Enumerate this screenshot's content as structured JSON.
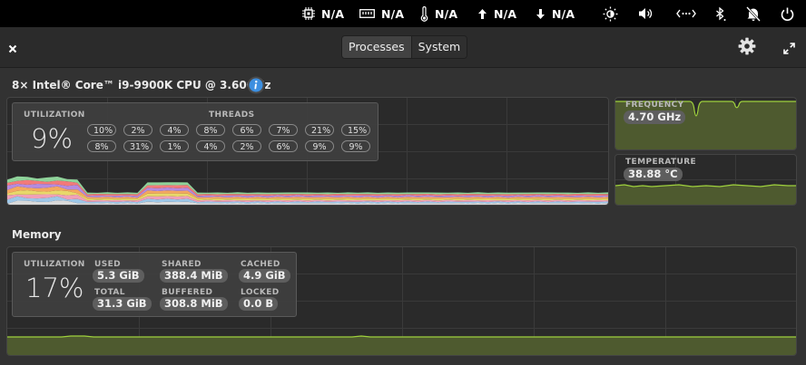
{
  "panel": {
    "cpu": "N/A",
    "memory": "N/A",
    "temperature": "N/A",
    "upload": "N/A",
    "download": "N/A",
    "icons": [
      "cpu-chip-icon",
      "memory-icon",
      "thermometer-icon",
      "arrow-up-icon",
      "arrow-down-icon",
      "brightness-icon",
      "volume-icon",
      "network-icon",
      "bluetooth-icon",
      "notifications-muted-icon",
      "power-icon"
    ]
  },
  "header": {
    "tabs": [
      "Processes",
      "System"
    ],
    "active_tab": "Processes"
  },
  "cpu": {
    "title": "8× Intel® Core™ i9-9900K CPU @ 3.60GHz",
    "utilization_label": "UTILIZATION",
    "utilization_value": "9%",
    "threads_label": "THREADS",
    "threads": [
      "10%",
      "2%",
      "4%",
      "8%",
      "6%",
      "7%",
      "21%",
      "15%",
      "8%",
      "31%",
      "1%",
      "4%",
      "2%",
      "6%",
      "9%",
      "9%"
    ],
    "frequency_label": "FREQUENCY",
    "frequency_value": "4.70 GHz",
    "temperature_label": "TEMPERATURE",
    "temperature_value": "38.88 °C"
  },
  "memory": {
    "title": "Memory",
    "utilization_label": "UTILIZATION",
    "utilization_value": "17%",
    "used_label": "USED",
    "used_value": "5.3 GiB",
    "total_label": "TOTAL",
    "total_value": "31.3 GiB",
    "shared_label": "SHARED",
    "shared_value": "388.4 MiB",
    "buffered_label": "BUFFERED",
    "buffered_value": "308.8 MiB",
    "cached_label": "CACHED",
    "cached_value": "4.9 GiB",
    "locked_label": "LOCKED",
    "locked_value": "0.0 B"
  },
  "colors": {
    "graph_fill": "#4e5a2f",
    "graph_line": "#9fd13d",
    "info_blue": "#3d8fe0"
  }
}
